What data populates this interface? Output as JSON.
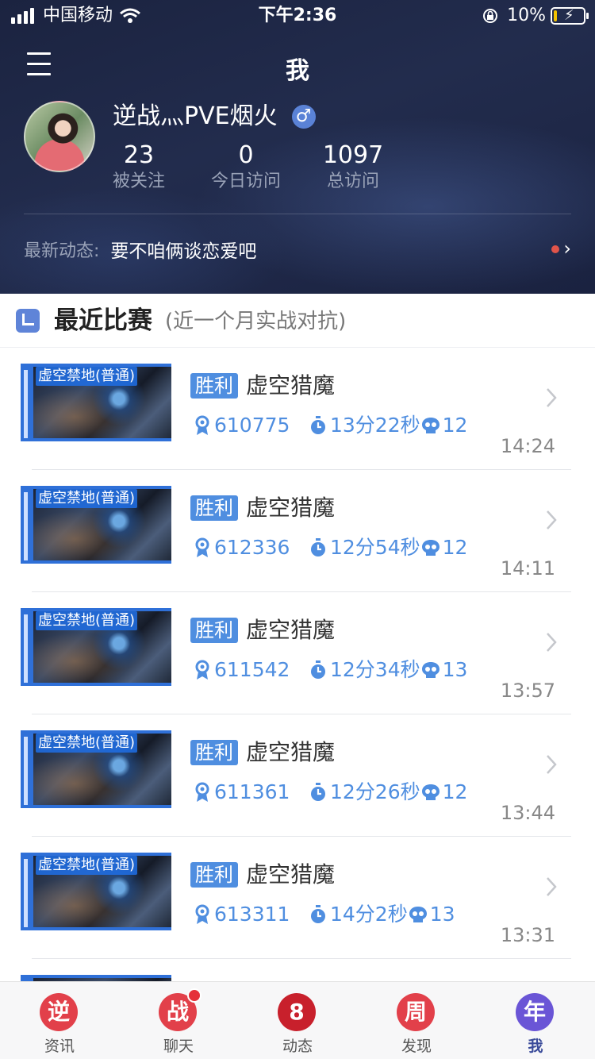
{
  "status_bar": {
    "carrier": "中国移动",
    "time": "下午2:36",
    "battery_percent": "10%",
    "battery_level": 0.1
  },
  "header": {
    "title": "我",
    "username": "逆战灬PVE烟火",
    "gender_symbol": "♂",
    "stats": [
      {
        "value": "23",
        "label": "被关注"
      },
      {
        "value": "0",
        "label": "今日访问"
      },
      {
        "value": "1097",
        "label": "总访问"
      }
    ],
    "feed_label": "最新动态:",
    "feed_text": "要不咱俩谈恋爱吧"
  },
  "section": {
    "title": "最近比赛",
    "subtitle": "(近一个月实战对抗)"
  },
  "matches": [
    {
      "map": "虚空禁地(普通)",
      "result": "胜利",
      "boss": "虚空猎魔",
      "score": "610775",
      "duration": "13分22秒",
      "kills": "12",
      "time": "14:24"
    },
    {
      "map": "虚空禁地(普通)",
      "result": "胜利",
      "boss": "虚空猎魔",
      "score": "612336",
      "duration": "12分54秒",
      "kills": "12",
      "time": "14:11"
    },
    {
      "map": "虚空禁地(普通)",
      "result": "胜利",
      "boss": "虚空猎魔",
      "score": "611542",
      "duration": "12分34秒",
      "kills": "13",
      "time": "13:57"
    },
    {
      "map": "虚空禁地(普通)",
      "result": "胜利",
      "boss": "虚空猎魔",
      "score": "611361",
      "duration": "12分26秒",
      "kills": "12",
      "time": "13:44"
    },
    {
      "map": "虚空禁地(普通)",
      "result": "胜利",
      "boss": "虚空猎魔",
      "score": "613311",
      "duration": "14分2秒",
      "kills": "13",
      "time": "13:31"
    }
  ],
  "tabbar": [
    {
      "glyph": "逆",
      "label": "资讯",
      "color": "#e2404a"
    },
    {
      "glyph": "战",
      "label": "聊天",
      "color": "#e2404a",
      "badge": true
    },
    {
      "glyph": "8",
      "label": "动态",
      "color": "#c8202c"
    },
    {
      "glyph": "周",
      "label": "发现",
      "color": "#e2404a"
    },
    {
      "glyph": "年",
      "label": "我",
      "color": "#6a55d6",
      "active": true
    }
  ],
  "colors": {
    "accent": "#4f8ee0",
    "header_bg": "#1f2746",
    "result_badge": "#4f8ee0"
  }
}
